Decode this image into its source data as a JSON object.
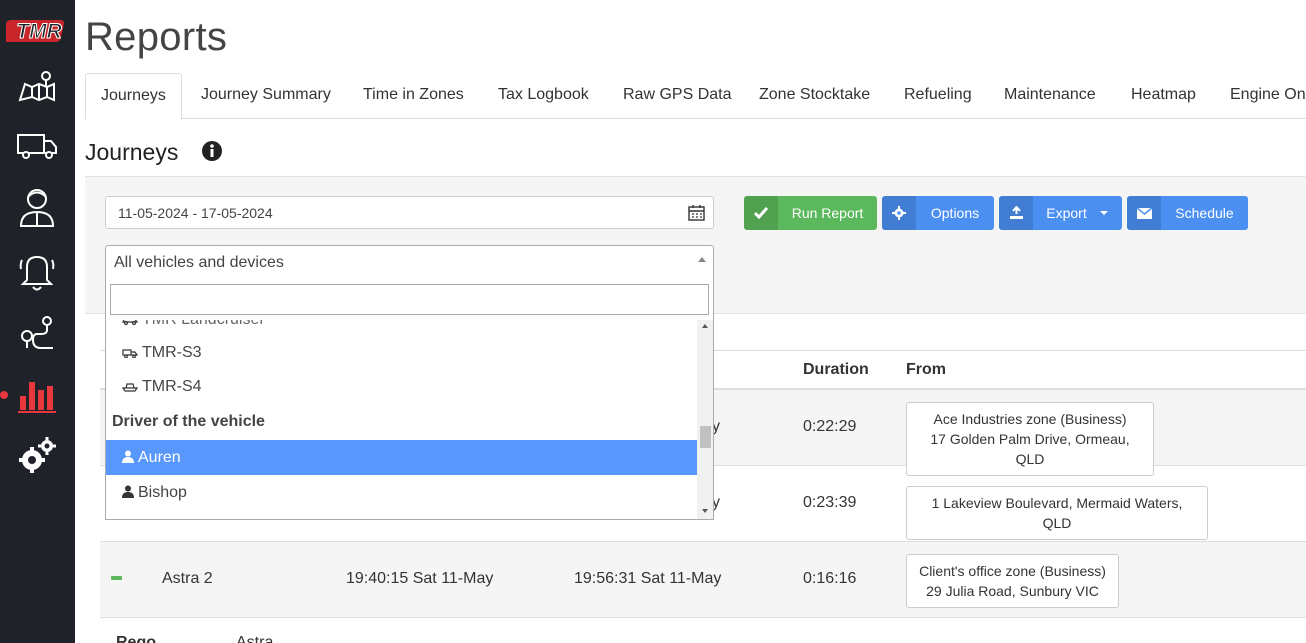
{
  "sidebar": {
    "logo_text": "TMR",
    "items": [
      {
        "icon": "map-icon"
      },
      {
        "icon": "truck-icon"
      },
      {
        "icon": "driver-icon"
      },
      {
        "icon": "bell-icon"
      },
      {
        "icon": "route-icon"
      },
      {
        "icon": "bar-chart-icon"
      },
      {
        "icon": "gears-icon"
      }
    ],
    "accent": "#e8383d"
  },
  "page": {
    "title": "Reports",
    "section_title": "Journeys"
  },
  "tabs": [
    {
      "label": "Journeys",
      "active": true
    },
    {
      "label": "Journey Summary"
    },
    {
      "label": "Time in Zones"
    },
    {
      "label": "Tax Logbook"
    },
    {
      "label": "Raw GPS Data"
    },
    {
      "label": "Zone Stocktake"
    },
    {
      "label": "Refueling"
    },
    {
      "label": "Maintenance"
    },
    {
      "label": "Heatmap"
    },
    {
      "label": "Engine On/"
    }
  ],
  "filters": {
    "date_range": "11-05-2024 - 17-05-2024",
    "vehicle_select": "All vehicles and devices",
    "search_value": ""
  },
  "buttons": {
    "run": "Run Report",
    "options": "Options",
    "export": "Export",
    "schedule": "Schedule"
  },
  "dropdown": {
    "partial_item": "TMR Landcruiser",
    "vehicles": [
      "TMR-S3",
      "TMR-S4"
    ],
    "group_label": "Driver of the vehicle",
    "drivers": [
      {
        "label": "Auren",
        "highlighted": true
      },
      {
        "label": "Bishop"
      }
    ],
    "highlight_color": "#5897fb"
  },
  "table": {
    "headers": {
      "duration": "Duration",
      "from": "From"
    },
    "rows": [
      {
        "start_tail": "y",
        "duration": "0:22:29",
        "from_line1": "Ace Industries zone (Business)",
        "from_line2": "17 Golden Palm Drive, Ormeau, QLD"
      },
      {
        "start_tail": "y",
        "duration": "0:23:39",
        "from_line1": "1 Lakeview Boulevard, Mermaid Waters, QLD"
      },
      {
        "vehicle": "Astra 2",
        "start": "19:40:15 Sat 11-May",
        "end": "19:56:31 Sat 11-May",
        "duration": "0:16:16",
        "from_line1": "Client's office zone (Business)",
        "from_line2": "29 Julia Road, Sunbury VIC"
      }
    ],
    "footer_partial": {
      "label": "Rego",
      "value": "Astra"
    }
  }
}
